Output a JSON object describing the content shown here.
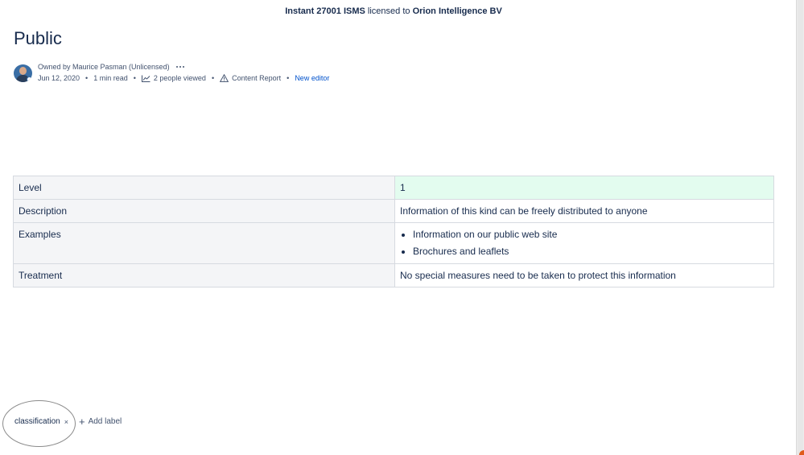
{
  "banner": {
    "product": "Instant 27001 ISMS",
    "licensed_to": "licensed to",
    "company": "Orion Intelligence BV"
  },
  "page": {
    "title": "Public"
  },
  "byline": {
    "owner": "Owned by Maurice Pasman (Unlicensed)",
    "date": "Jun 12, 2020",
    "read_time": "1 min read",
    "viewers": "2 people viewed",
    "report": "Content Report",
    "editor": "New editor",
    "separator": "•"
  },
  "table": {
    "level_key": "Level",
    "level_value": "1",
    "description_key": "Description",
    "description_value": "Information of this kind can be freely distributed to anyone",
    "examples_key": "Examples",
    "examples": [
      "Information on our public web site",
      "Brochures and leaflets"
    ],
    "treatment_key": "Treatment",
    "treatment_value": "No special measures need to be taken to protect this information"
  },
  "labels": {
    "items": [
      "classification"
    ],
    "remove_glyph": "×",
    "add_label": "Add label",
    "add_glyph": "+"
  },
  "colors": {
    "level_highlight": "#e3fcef",
    "link": "#0052cc",
    "key_cell": "#f4f5f7"
  }
}
